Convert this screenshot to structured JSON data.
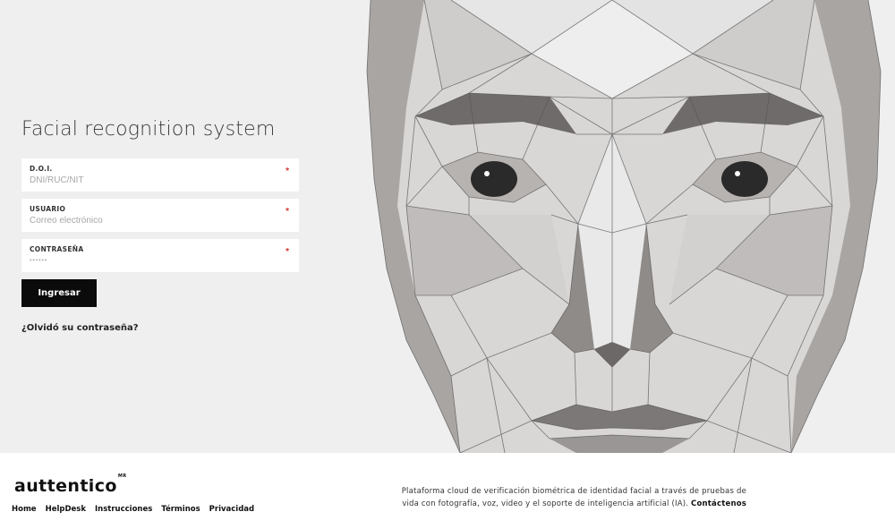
{
  "login": {
    "title": "Facial recognition system",
    "fields": [
      {
        "label": "D.O.I.",
        "placeholder": "DNI/RUC/NIT",
        "required": "*"
      },
      {
        "label": "USUARIO",
        "placeholder": "Correo electrónico",
        "required": "*"
      },
      {
        "label": "CONTRASEÑA",
        "value_mask": "••••••",
        "required": "*"
      }
    ],
    "submit_label": "Ingresar",
    "forgot_label": "¿Olvidó su contraseña?"
  },
  "footer": {
    "brand": "auttentico",
    "brand_mark": "MR",
    "nav": [
      "Home",
      "HelpDesk",
      "Instrucciones",
      "Términos",
      "Privacidad"
    ],
    "description_line1": "Plataforma cloud de verificación biométrica de identidad facial a través de pruebas de",
    "description_line2": "vida con fotografía, voz, video y el soporte de inteligencia artificial (IA).",
    "contact_label": "Contáctenos"
  },
  "colors": {
    "hero_bg": "#efefef",
    "button_bg": "#0b0b0b",
    "required_mark": "#d0392f"
  },
  "icons": {
    "hero_art": "polygon-face-illustration"
  }
}
